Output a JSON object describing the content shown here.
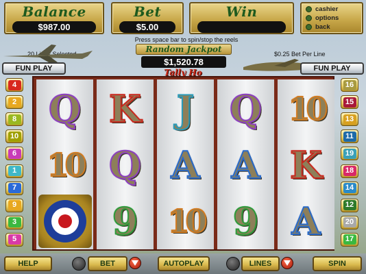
{
  "header": {
    "balance": {
      "title": "Balance",
      "value": "$987.00"
    },
    "bet": {
      "title": "Bet",
      "value": "$5.00"
    },
    "win": {
      "title": "Win",
      "value": ""
    },
    "menu": [
      {
        "label": "cashier",
        "icon": "cashier-icon"
      },
      {
        "label": "options",
        "icon": "options-icon"
      },
      {
        "label": "back",
        "icon": "back-icon"
      }
    ],
    "spin_hint": "Press space bar to spin/stop the reels",
    "lines_selected": "20 Lines Selected",
    "bet_per_line": "$0.25 Bet Per Line",
    "jackpot": {
      "title": "Random Jackpot",
      "value": "$1,520.78"
    },
    "fun_play_left": "FUN PLAY",
    "fun_play_right": "FUN PLAY",
    "logo_text": "Tally Ho"
  },
  "reels": [
    {
      "symbols": [
        {
          "s": "Q",
          "color": "#8c3fbf"
        },
        {
          "s": "10",
          "color": "#d07a20"
        },
        {
          "s": "ROUNDEL",
          "color": "#c8a030"
        }
      ]
    },
    {
      "symbols": [
        {
          "s": "K",
          "color": "#c8281e"
        },
        {
          "s": "Q",
          "color": "#8c3fbf"
        },
        {
          "s": "9",
          "color": "#2e9a3a"
        }
      ]
    },
    {
      "symbols": [
        {
          "s": "J",
          "color": "#2a9ab8"
        },
        {
          "s": "A",
          "color": "#2a6ac8"
        },
        {
          "s": "10",
          "color": "#d07a20"
        }
      ]
    },
    {
      "symbols": [
        {
          "s": "Q",
          "color": "#8c3fbf"
        },
        {
          "s": "A",
          "color": "#2a6ac8"
        },
        {
          "s": "9",
          "color": "#2e9a3a"
        }
      ]
    },
    {
      "symbols": [
        {
          "s": "10",
          "color": "#d07a20"
        },
        {
          "s": "K",
          "color": "#c8281e"
        },
        {
          "s": "A",
          "color": "#2a6ac8"
        }
      ]
    }
  ],
  "left_lines": [
    {
      "n": "4",
      "color": "#d8281e"
    },
    {
      "n": "2",
      "color": "#e8a820"
    },
    {
      "n": "8",
      "color": "#9ab820"
    },
    {
      "n": "10",
      "color": "#a0a000"
    },
    {
      "n": "6",
      "color": "#c83ab8"
    },
    {
      "n": "1",
      "color": "#40b8c8"
    },
    {
      "n": "7",
      "color": "#2a6ad8"
    },
    {
      "n": "9",
      "color": "#e8a820"
    },
    {
      "n": "3",
      "color": "#3ab840"
    },
    {
      "n": "5",
      "color": "#d83aa8"
    }
  ],
  "right_lines": [
    {
      "n": "16",
      "color": "#a89a40"
    },
    {
      "n": "15",
      "color": "#a8183a"
    },
    {
      "n": "13",
      "color": "#d8a020"
    },
    {
      "n": "11",
      "color": "#1e6aa8"
    },
    {
      "n": "19",
      "color": "#3aa0b8"
    },
    {
      "n": "18",
      "color": "#d82868"
    },
    {
      "n": "14",
      "color": "#2a8ac8"
    },
    {
      "n": "12",
      "color": "#2e7a2a"
    },
    {
      "n": "20",
      "color": "#a8a8a8"
    },
    {
      "n": "17",
      "color": "#3ab840"
    }
  ],
  "bottom": {
    "help": "HELP",
    "bet": "BET",
    "autoplay": "AUTOPLAY",
    "lines": "LINES",
    "spin": "SPIN"
  }
}
